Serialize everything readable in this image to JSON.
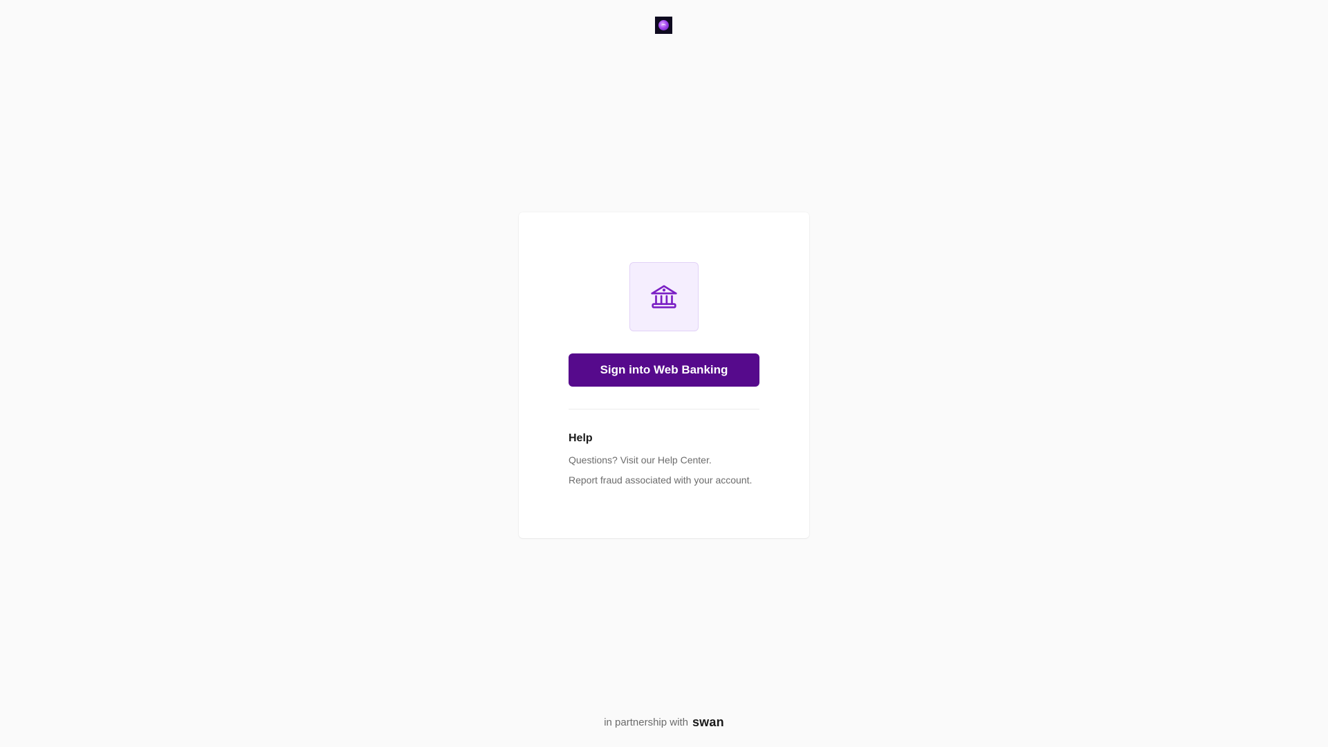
{
  "header": {
    "logo_icon": "purple-orb-logo-icon"
  },
  "card": {
    "bank_icon": "bank-building-icon",
    "signin_label": "Sign into Web Banking",
    "help": {
      "title": "Help",
      "line1_prefix": "Questions? Visit our ",
      "line1_link": "Help Center",
      "line1_suffix": ".",
      "line2_link": "Report fraud",
      "line2_suffix": " associated with your account."
    }
  },
  "footer": {
    "prefix": "in partnership with",
    "brand": "swan"
  },
  "colors": {
    "background": "#fafafa",
    "accent": "#560a8c",
    "tile_bg": "#f5eefe",
    "icon": "#7a1fc4"
  }
}
